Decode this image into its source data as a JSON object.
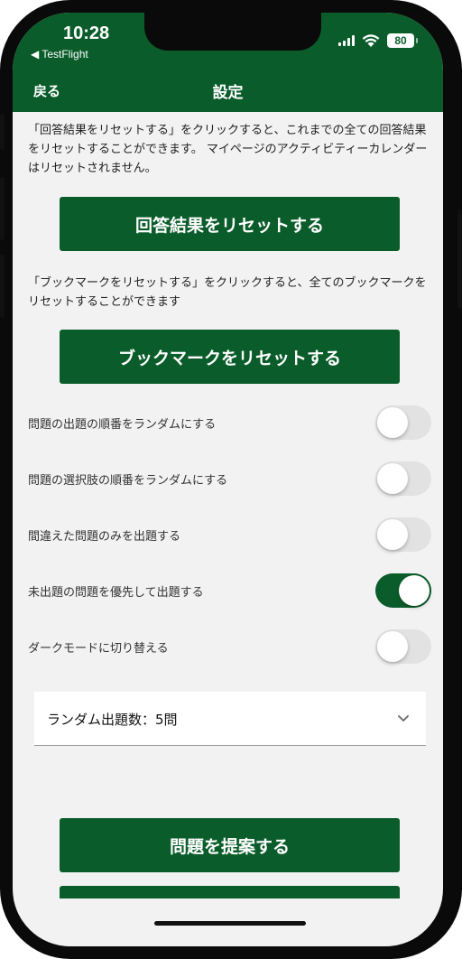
{
  "status_bar": {
    "time": "10:28",
    "back_app": "◀ TestFlight",
    "battery": "80"
  },
  "nav": {
    "back_label": "戻る",
    "title": "設定"
  },
  "reset_results": {
    "description": "「回答結果をリセットする」をクリックすると、これまでの全ての回答結果をリセットすることができます。 マイページのアクティビティーカレンダーはリセットされません。",
    "button_label": "回答結果をリセットする"
  },
  "reset_bookmarks": {
    "description": "「ブックマークをリセットする」をクリックすると、全てのブックマークをリセットすることができます",
    "button_label": "ブックマークをリセットする"
  },
  "toggles": [
    {
      "label": "問題の出題の順番をランダムにする",
      "on": false
    },
    {
      "label": "問題の選択肢の順番をランダムにする",
      "on": false
    },
    {
      "label": "間違えた問題のみを出題する",
      "on": false
    },
    {
      "label": "未出題の問題を優先して出題する",
      "on": true
    },
    {
      "label": "ダークモードに切り替える",
      "on": false
    }
  ],
  "random_count_select": {
    "selected": "ランダム出題数：5問"
  },
  "suggest_button": {
    "label": "問題を提案する"
  },
  "colors": {
    "brand_green": "#0a5d2a",
    "background": "#f2f2f2"
  }
}
